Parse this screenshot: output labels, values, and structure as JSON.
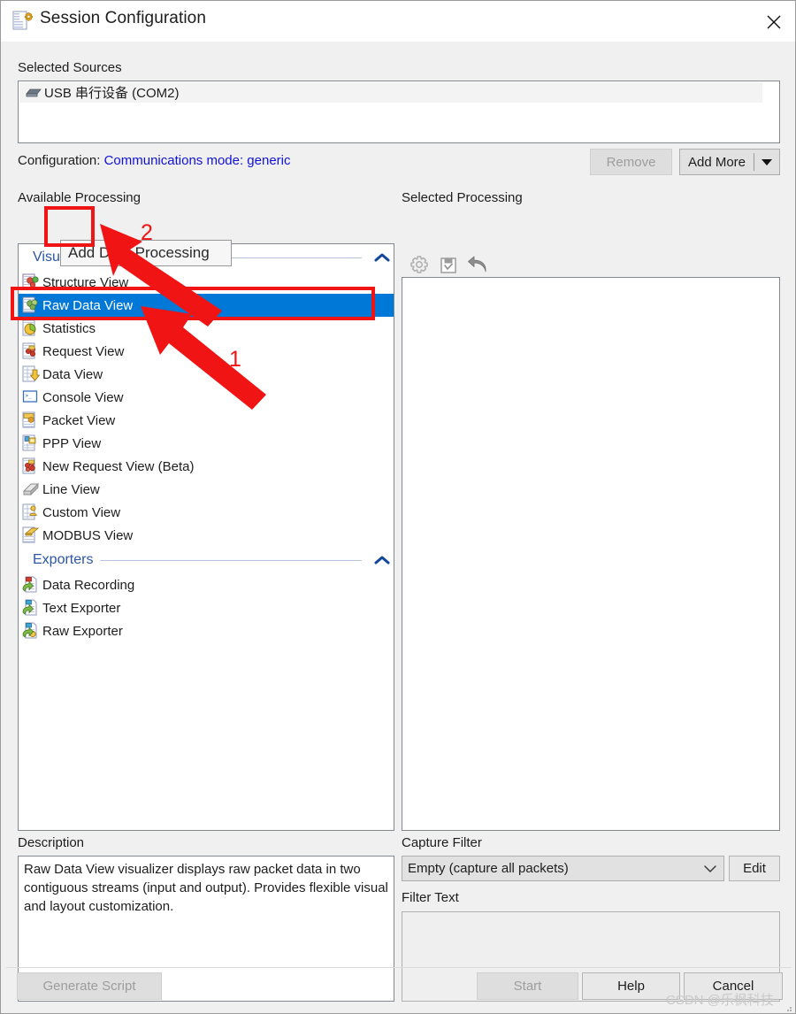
{
  "window": {
    "title": "Session Configuration",
    "icon": "config-document-icon",
    "close_label": "×"
  },
  "sources": {
    "label": "Selected Sources",
    "items": [
      {
        "name": "USB 串行设备 (COM2)",
        "icon": "serial-device-icon"
      }
    ],
    "configuration_prefix": "Configuration:",
    "configuration_value": "Communications mode: generic",
    "remove_label": "Remove",
    "add_more_label": "Add More"
  },
  "available": {
    "label": "Available Processing",
    "toolbar": [
      {
        "name": "remove-processing",
        "icon": "grey-x-icon",
        "enabled": false
      },
      {
        "name": "add-data-processing",
        "icon": "green-arrow-icon",
        "enabled": true
      }
    ],
    "tooltip": "Add Data Processing",
    "groups": [
      {
        "name": "Visualizers",
        "collapsed": false,
        "items": [
          {
            "label": "Structure View",
            "icon": "structure-view-icon",
            "selected": false
          },
          {
            "label": "Raw Data View",
            "icon": "raw-data-view-icon",
            "selected": true
          },
          {
            "label": "Statistics",
            "icon": "statistics-icon",
            "selected": false
          },
          {
            "label": "Request View",
            "icon": "request-view-icon",
            "selected": false
          },
          {
            "label": "Data View",
            "icon": "data-view-icon",
            "selected": false
          },
          {
            "label": "Console View",
            "icon": "console-view-icon",
            "selected": false
          },
          {
            "label": "Packet View",
            "icon": "packet-view-icon",
            "selected": false
          },
          {
            "label": "PPP View",
            "icon": "ppp-view-icon",
            "selected": false
          },
          {
            "label": "New Request View (Beta)",
            "icon": "new-request-view-icon",
            "selected": false
          },
          {
            "label": "Line View",
            "icon": "line-view-icon",
            "selected": false
          },
          {
            "label": "Custom View",
            "icon": "custom-view-icon",
            "selected": false
          },
          {
            "label": "MODBUS View",
            "icon": "modbus-view-icon",
            "selected": false
          }
        ]
      },
      {
        "name": "Exporters",
        "collapsed": false,
        "items": [
          {
            "label": "Data Recording",
            "icon": "data-recording-icon",
            "selected": false
          },
          {
            "label": "Text Exporter",
            "icon": "text-exporter-icon",
            "selected": false
          },
          {
            "label": "Raw Exporter",
            "icon": "raw-exporter-icon",
            "selected": false
          }
        ]
      }
    ]
  },
  "selected_processing": {
    "label": "Selected Processing",
    "toolbar": [
      {
        "name": "configure",
        "icon": "gear-icon",
        "enabled": false
      },
      {
        "name": "save",
        "icon": "save-icon",
        "enabled": false
      },
      {
        "name": "undo",
        "icon": "undo-arrow-icon",
        "enabled": true
      }
    ],
    "items": []
  },
  "description": {
    "label": "Description",
    "text": "Raw Data View visualizer displays raw packet data in two contiguous streams (input and output). Provides flexible visual and layout customization."
  },
  "capture_filter": {
    "label": "Capture Filter",
    "value": "Empty (capture all packets)",
    "options": [
      "Empty (capture all packets)"
    ],
    "edit_label": "Edit"
  },
  "filter_text": {
    "label": "Filter Text",
    "value": ""
  },
  "footer": {
    "generate_script_label": "Generate Script",
    "start_label": "Start",
    "help_label": "Help",
    "cancel_label": "Cancel"
  },
  "annotations": {
    "markers": [
      {
        "id": "1",
        "label": "1"
      },
      {
        "id": "2",
        "label": "2"
      }
    ],
    "color": "#f01414"
  },
  "watermark": "CSDN @乐枫科技"
}
